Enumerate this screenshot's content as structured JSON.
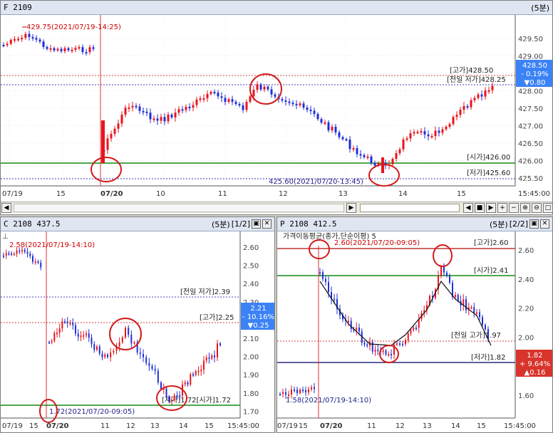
{
  "top": {
    "title": "F 2109",
    "interval": "(5분)",
    "y_ticks": [
      "429.50",
      "429.00",
      "428.50",
      "428.00",
      "427.50",
      "427.00",
      "426.50",
      "426.00",
      "425.50"
    ],
    "x_ticks": [
      "07/19",
      "15",
      "07/20",
      "10",
      "11",
      "12",
      "13",
      "14",
      "15",
      "15:45:00"
    ],
    "annot_high_prev": "429.75(2021/07/19-14:25)",
    "annot_low": "425.60(2021/07/20-13:45)",
    "label_high": "[고가]428.50",
    "label_prev_low": "[전일 저가]428.25",
    "label_open": "[시가]426.00",
    "label_low": "[저가]425.60",
    "price_box": {
      "price": "428.50",
      "pct": "- 0.19%",
      "chg": "▼0.80"
    }
  },
  "bottom_left": {
    "title": "C 2108 437.5",
    "interval": "(5분)",
    "page": "[1/2]",
    "y_ticks": [
      "2.60",
      "2.50",
      "2.40",
      "2.30",
      "2.20",
      "2.10",
      "2.00",
      "1.90",
      "1.80",
      "1.70"
    ],
    "x_ticks": [
      "07/19",
      "15",
      "07/20",
      "11",
      "12",
      "13",
      "14",
      "15",
      "15:45:00"
    ],
    "annot_high_prev": "2.58(2021/07/19-14:10)",
    "annot_low": "1.72(2021/07/20-09:05)",
    "label_prev_low": "[전일 저가]2.39",
    "label_high": "[고가]2.25",
    "label_low_open": "[저가]1.72[시가]1.72",
    "price_box": {
      "price": "2.21",
      "pct": "- 10.16%",
      "chg": "▼0.25"
    }
  },
  "bottom_right": {
    "title": "P 2108 412.5",
    "interval": "(5분)",
    "page": "[2/2]",
    "ma_label": "가격이동평균(종가,단순이평) 5",
    "y_ticks": [
      "2.60",
      "2.40",
      "2.20",
      "2.00",
      "1.80",
      "1.60"
    ],
    "x_ticks": [
      "07/19",
      "15",
      "07/20",
      "11",
      "12",
      "13",
      "14",
      "15",
      "15:45:00"
    ],
    "annot_high": "2.60(2021/07/20-09:05)",
    "annot_low_prev": "1.58(2021/07/19-14:10)",
    "label_high": "[고가]2.60",
    "label_open": "[시가]2.41",
    "label_prev_high": "[전일 고가]1.97",
    "label_low": "[저가]1.82",
    "price_box": {
      "price": "1.82",
      "pct": "+ 9.64%",
      "chg": "▲0.16"
    }
  },
  "colors": {
    "up": "#e8141c",
    "down": "#1f2fd6",
    "green": "#148c14",
    "accent": "#3b82f6"
  }
}
